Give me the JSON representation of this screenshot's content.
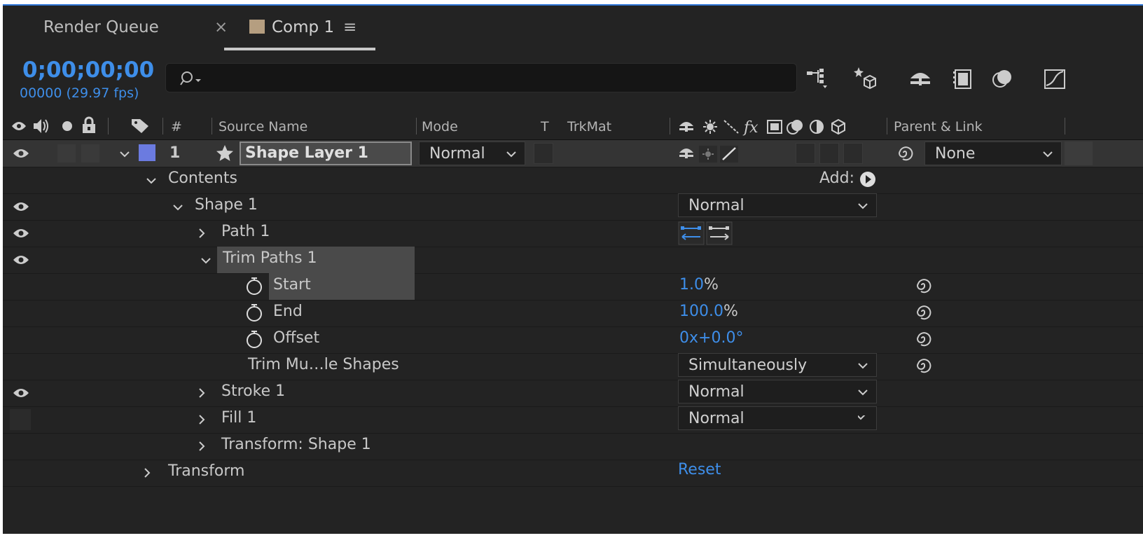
{
  "tabs": [
    {
      "label": "Render Queue"
    },
    {
      "label": "Comp 1"
    }
  ],
  "tab_close_glyph": "×",
  "tab_menu_glyph": "≡",
  "comp_swatch_color": "#b59e80",
  "timecode": "0;00;00;00",
  "frame_info": "00000 (29.97 fps)",
  "search": {
    "placeholder": ""
  },
  "columns": {
    "number": "#",
    "source_name": "Source Name",
    "mode": "Mode",
    "t": "T",
    "trkmat": "TrkMat",
    "parent_link": "Parent & Link"
  },
  "layer": {
    "number": "1",
    "name": "Shape Layer 1",
    "label_color": "#6b7be0",
    "mode": "Normal",
    "parent": "None"
  },
  "rows": {
    "contents": "Contents",
    "add_label": "Add:",
    "shape1": "Shape 1",
    "shape1_blend": "Normal",
    "path1": "Path 1",
    "trim_paths": "Trim Paths 1",
    "start_label": "Start",
    "start_value": "1.0",
    "start_unit": "%",
    "end_label": "End",
    "end_value": "100.0",
    "end_unit": "%",
    "offset_label": "Offset",
    "offset_value": "0x+0.0°",
    "trim_multiple_label": "Trim Mu…le Shapes",
    "trim_multiple_value": "Simultaneously",
    "stroke1": "Stroke 1",
    "stroke1_blend": "Normal",
    "fill1": "Fill 1",
    "fill1_blend": "Normal",
    "transform_shape": "Transform: Shape 1",
    "transform": "Transform",
    "reset": "Reset"
  },
  "colors": {
    "accent_blue": "#3e8ee9",
    "panel_bg": "#232323",
    "layer_row_bg": "#343434"
  }
}
